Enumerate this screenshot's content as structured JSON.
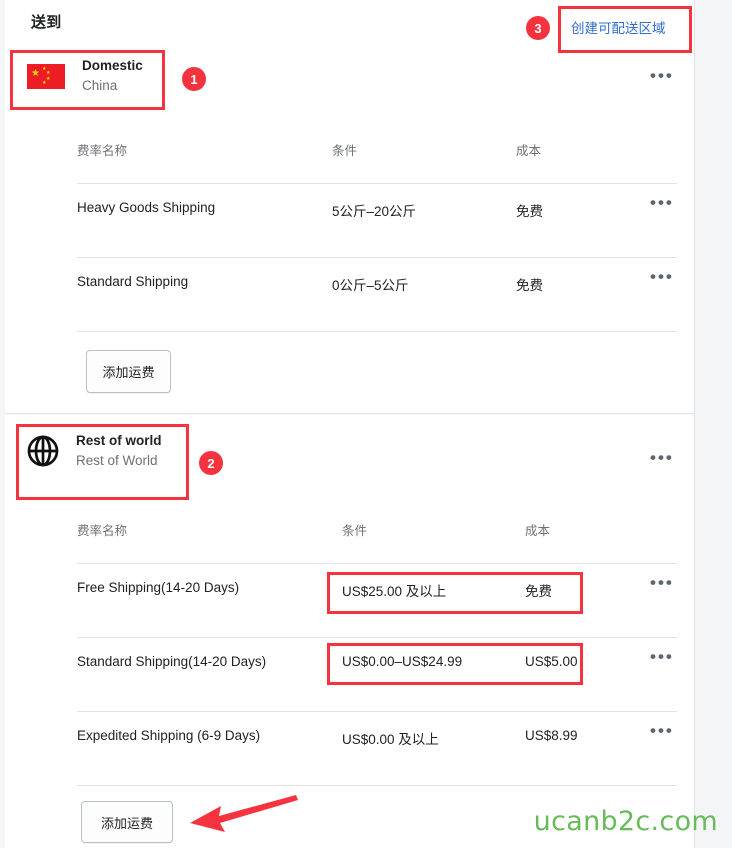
{
  "header": {
    "title": "送到",
    "create_zone_label": "创建可配送区域"
  },
  "columns": {
    "name": "费率名称",
    "condition": "条件",
    "cost": "成本"
  },
  "zones": [
    {
      "icon": "china-flag-icon",
      "name": "Domestic",
      "subtitle": "China",
      "add_rate_label": "添加运费",
      "rows": [
        {
          "name": "Heavy Goods Shipping",
          "condition": "5公斤–20公斤",
          "cost": "免费"
        },
        {
          "name": "Standard Shipping",
          "condition": "0公斤–5公斤",
          "cost": "免费"
        }
      ]
    },
    {
      "icon": "globe-icon",
      "name": "Rest of world",
      "subtitle": "Rest of World",
      "add_rate_label": "添加运费",
      "rows": [
        {
          "name": "Free Shipping(14-20 Days)",
          "condition": "US$25.00 及以上",
          "cost": "免费"
        },
        {
          "name": "Standard Shipping(14-20 Days)",
          "condition": "US$0.00–US$24.99",
          "cost": "US$5.00"
        },
        {
          "name": "Expedited Shipping (6-9 Days)",
          "condition": "US$0.00 及以上",
          "cost": "US$8.99"
        }
      ]
    }
  ],
  "overflow_menu_label": "•••",
  "annotations": {
    "badges": [
      "1",
      "2",
      "3"
    ],
    "highlight_color": "#f5333f",
    "arrow_color": "#f5333f"
  },
  "watermark": "ucanb2c.com"
}
